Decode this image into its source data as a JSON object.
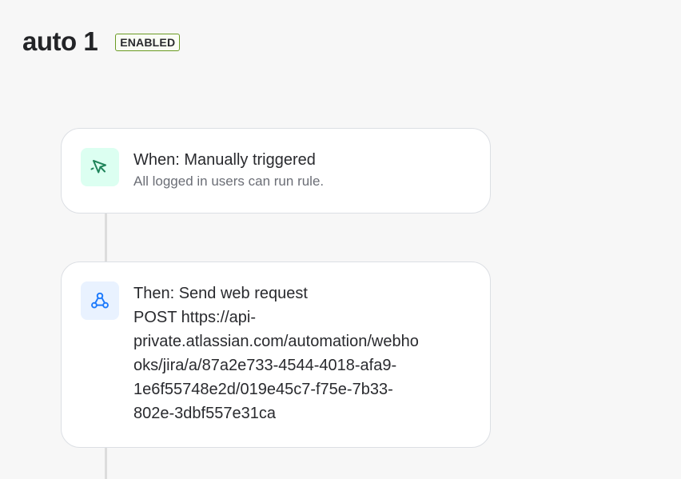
{
  "rule": {
    "title": "auto 1",
    "status_badge": "ENABLED"
  },
  "trigger": {
    "heading": "When: Manually triggered",
    "description": "All logged in users can run rule.",
    "icon": "cursor-click-icon",
    "icon_color": "#1f845a",
    "icon_bg": "#dcfff1"
  },
  "action": {
    "heading": "Then: Send web request",
    "line1": "POST https://api-",
    "line2": "private.atlassian.com/automation/webho",
    "line3": "oks/jira/a/87a2e733-4544-4018-afa9-",
    "line4": "1e6f55748e2d/019e45c7-f75e-7b33-",
    "line5": "802e-3dbf557e31ca",
    "icon": "webhook-icon",
    "icon_color": "#1d7afc",
    "icon_bg": "#e9f2ff"
  }
}
